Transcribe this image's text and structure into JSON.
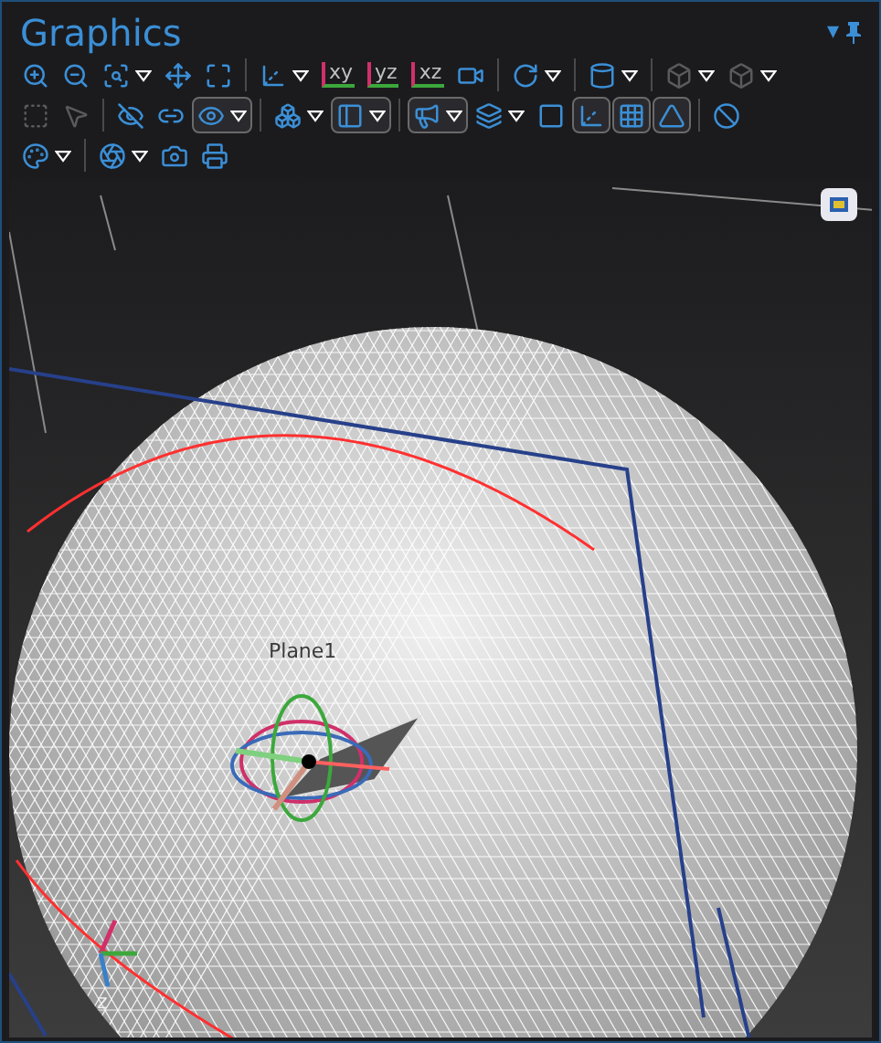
{
  "panel": {
    "title": "Graphics",
    "menu_glyph": "▾"
  },
  "toolbar_rows": [
    [
      {
        "kind": "button",
        "dropdown": false,
        "disabled": false,
        "pressed": false
      },
      {
        "kind": "button",
        "dropdown": false,
        "disabled": false,
        "pressed": false
      },
      {
        "kind": "button",
        "dropdown": true,
        "disabled": false,
        "pressed": false
      },
      {
        "kind": "button",
        "dropdown": false,
        "disabled": false,
        "pressed": false
      },
      {
        "kind": "button",
        "dropdown": false,
        "disabled": false,
        "pressed": false
      },
      {
        "kind": "separator"
      },
      {
        "kind": "button",
        "dropdown": true,
        "disabled": false,
        "pressed": false
      },
      {
        "kind": "plane",
        "label": "xy",
        "dropdown": false,
        "disabled": false,
        "pressed": false
      },
      {
        "kind": "plane",
        "label": "yz",
        "dropdown": false,
        "disabled": false,
        "pressed": false
      },
      {
        "kind": "plane",
        "label": "xz",
        "dropdown": false,
        "disabled": false,
        "pressed": false
      },
      {
        "kind": "button",
        "dropdown": false,
        "disabled": false,
        "pressed": false
      },
      {
        "kind": "separator"
      },
      {
        "kind": "button",
        "dropdown": true,
        "disabled": false,
        "pressed": false
      },
      {
        "kind": "separator"
      },
      {
        "kind": "button",
        "dropdown": true,
        "disabled": false,
        "pressed": false
      },
      {
        "kind": "separator"
      },
      {
        "kind": "button",
        "dropdown": true,
        "disabled": true,
        "pressed": false
      },
      {
        "kind": "button",
        "dropdown": true,
        "disabled": true,
        "pressed": false
      }
    ],
    [
      {
        "kind": "button",
        "dropdown": false,
        "disabled": true,
        "pressed": false
      },
      {
        "kind": "button",
        "dropdown": false,
        "disabled": true,
        "pressed": false
      },
      {
        "kind": "separator"
      },
      {
        "kind": "button",
        "dropdown": false,
        "disabled": false,
        "pressed": false
      },
      {
        "kind": "button",
        "dropdown": false,
        "disabled": false,
        "pressed": false
      },
      {
        "kind": "button",
        "dropdown": true,
        "disabled": false,
        "pressed": true
      },
      {
        "kind": "separator"
      },
      {
        "kind": "button",
        "dropdown": true,
        "disabled": false,
        "pressed": false
      },
      {
        "kind": "button",
        "dropdown": true,
        "disabled": false,
        "pressed": true
      },
      {
        "kind": "separator"
      },
      {
        "kind": "button",
        "dropdown": true,
        "disabled": false,
        "pressed": true
      },
      {
        "kind": "button",
        "dropdown": true,
        "disabled": false,
        "pressed": false
      },
      {
        "kind": "button",
        "dropdown": false,
        "disabled": false,
        "pressed": false
      },
      {
        "kind": "button",
        "dropdown": false,
        "disabled": false,
        "pressed": true
      },
      {
        "kind": "button",
        "dropdown": false,
        "disabled": false,
        "pressed": true
      },
      {
        "kind": "button",
        "dropdown": false,
        "disabled": false,
        "pressed": true
      },
      {
        "kind": "separator"
      },
      {
        "kind": "button",
        "dropdown": false,
        "disabled": false,
        "pressed": false
      }
    ],
    [
      {
        "kind": "button",
        "dropdown": true,
        "disabled": false,
        "pressed": false
      },
      {
        "kind": "separator"
      },
      {
        "kind": "button",
        "dropdown": true,
        "disabled": false,
        "pressed": false
      },
      {
        "kind": "button",
        "dropdown": false,
        "disabled": false,
        "pressed": false
      },
      {
        "kind": "button",
        "dropdown": false,
        "disabled": false,
        "pressed": false
      }
    ]
  ],
  "viewport": {
    "plane_label": "Plane1",
    "axis_label": "z"
  }
}
